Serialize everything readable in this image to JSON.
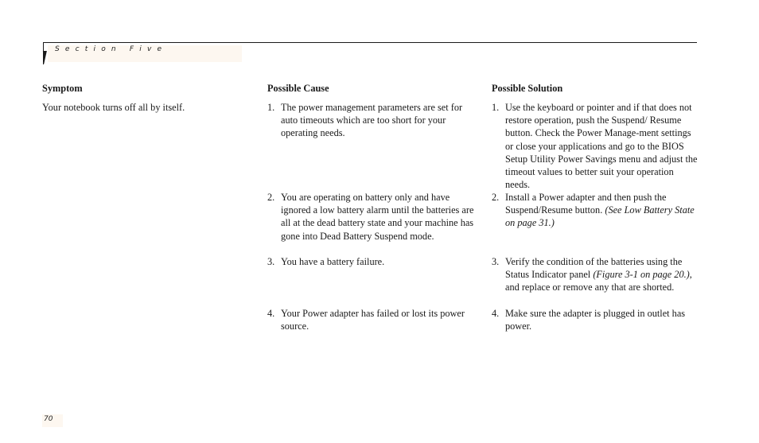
{
  "header": {
    "section_label": "Section Five"
  },
  "table": {
    "columns": [
      "Symptom",
      "Possible Cause",
      "Possible Solution"
    ],
    "symptom": "Your notebook turns off all by itself.",
    "causes": [
      {
        "num": "1.",
        "text": "The power management parameters are set for auto timeouts which are too short for your operating needs."
      },
      {
        "num": "2.",
        "text": "You are operating on battery only and have ignored a low battery alarm until the batteries are all at the dead battery state and your machine has gone into Dead Battery Suspend mode."
      },
      {
        "num": "3.",
        "text": "You have a battery failure."
      },
      {
        "num": "4.",
        "text": "Your Power adapter has failed or lost its power source."
      }
    ],
    "solutions": [
      {
        "num": "1.",
        "text": "Use the keyboard or pointer and if that does not restore operation, push the Suspend/ Resume button. Check the Power Manage-ment settings or close your applications and go to the BIOS Setup Utility Power Savings menu and adjust the timeout values to better suit your operation needs.",
        "ref": ""
      },
      {
        "num": "2.",
        "text": "Install a Power adapter and then push the Suspend/Resume button. ",
        "ref": "(See Low Battery State on page 31.)"
      },
      {
        "num": "3.",
        "text_before": "Verify the condition of the batteries using the Status Indicator panel ",
        "ref": "(Figure 3-1 on page 20.)",
        "text_after": ", and replace or remove any that are shorted."
      },
      {
        "num": "4.",
        "text": "Make sure the adapter is plugged in outlet has power.",
        "ref": ""
      }
    ]
  },
  "footer": {
    "page_number": "70"
  }
}
